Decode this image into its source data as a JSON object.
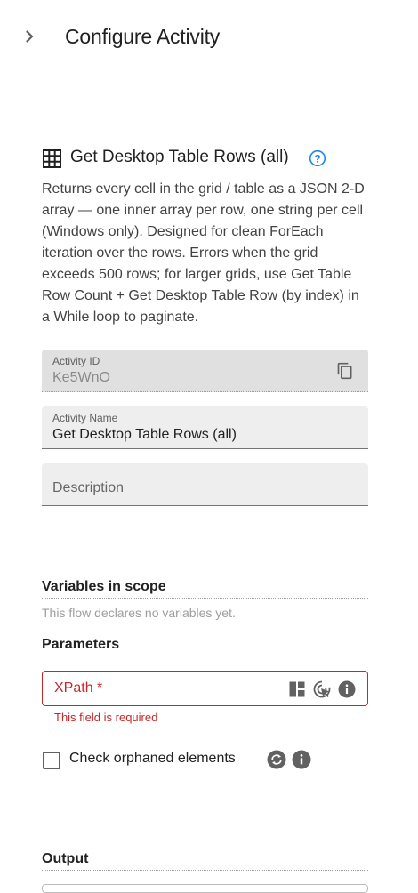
{
  "header": {
    "title": "Configure Activity"
  },
  "activity": {
    "title": "Get Desktop Table Rows (all)",
    "description": "Returns every cell in the grid / table as a JSON 2-D array — one inner array per row, one string per cell (Windows only). Designed for clean ForEach iteration over the rows. Errors when the grid exceeds 500 rows; for larger grids, use Get Table Row Count + Get Desktop Table Row (by index) in a While loop to paginate."
  },
  "fields": {
    "activity_id": {
      "label": "Activity ID",
      "value": "Ke5WnO"
    },
    "activity_name": {
      "label": "Activity Name",
      "value": "Get Desktop Table Rows (all)"
    },
    "description": {
      "placeholder": "Description"
    }
  },
  "variables": {
    "heading": "Variables in scope",
    "empty_text": "This flow declares no variables yet."
  },
  "parameters": {
    "heading": "Parameters",
    "xpath": {
      "label": "XPath *",
      "error": "This field is required"
    },
    "check_orphaned": {
      "label": "Check orphaned elements",
      "checked": false
    }
  },
  "output": {
    "heading": "Output"
  },
  "icons": {
    "back": "chevron-right-icon",
    "activity": "table-grid-icon",
    "help": "help-circle-icon",
    "copy": "copy-icon",
    "layout": "layout-icon",
    "pick": "pick-element-icon",
    "info": "info-icon",
    "refresh": "refresh-icon"
  },
  "colors": {
    "accent": "#1e88e5",
    "error": "#c62828",
    "icon": "#616161"
  }
}
